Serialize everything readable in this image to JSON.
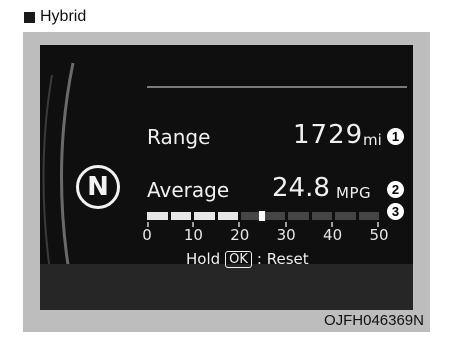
{
  "header": {
    "icon": "black-square-icon",
    "label": "Hybrid"
  },
  "screen": {
    "gear": "N",
    "range": {
      "label": "Range",
      "value": "1729",
      "unit": "mi",
      "badge": "1"
    },
    "average": {
      "label": "Average",
      "value": "24.8",
      "unit": "MPG",
      "badge": "2"
    },
    "fuel_bar": {
      "badge": "3",
      "scale": [
        "0",
        "10",
        "20",
        "30",
        "40",
        "50"
      ],
      "level_mpg": 24.8,
      "max_mpg": 50
    },
    "hold": {
      "prefix": "Hold",
      "button": "OK",
      "suffix": ": Reset"
    }
  },
  "figure_code": "OJFH046369N",
  "colors": {
    "screen": "#0f0f0f",
    "frame": "#bdbdbd",
    "text": "#f0f0f0"
  }
}
